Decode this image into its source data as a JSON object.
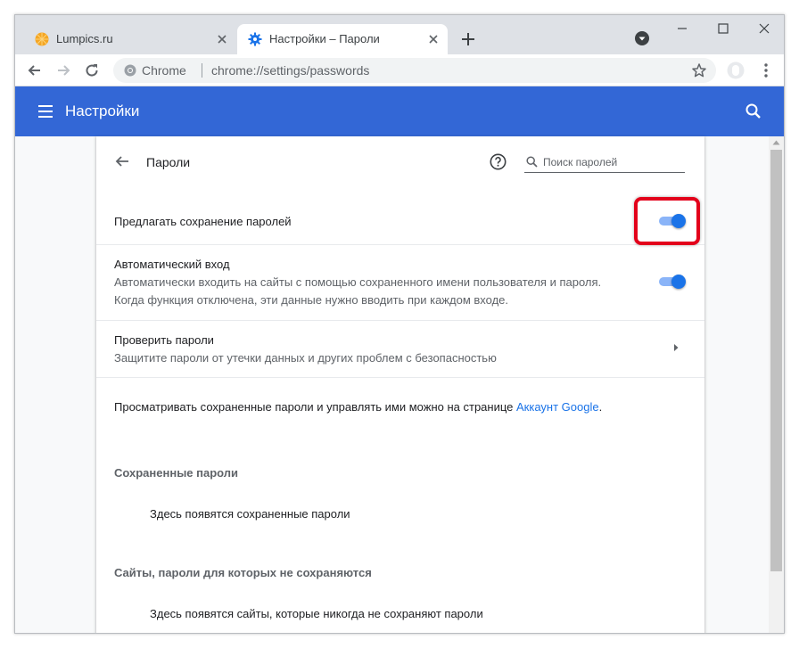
{
  "tabs": [
    {
      "title": "Lumpics.ru",
      "favicon": "orange-circle-icon",
      "active": false
    },
    {
      "title": "Настройки – Пароли",
      "favicon": "gear-icon",
      "active": true
    }
  ],
  "toolbar": {
    "site_name": "Chrome",
    "url": "chrome://settings/passwords"
  },
  "header": {
    "title": "Настройки"
  },
  "passwords_page": {
    "title": "Пароли",
    "search_placeholder": "Поиск паролей",
    "offer_save": {
      "label": "Предлагать сохранение паролей",
      "enabled": true
    },
    "auto_signin": {
      "label": "Автоматический вход",
      "description_line1": "Автоматически входить на сайты с помощью сохраненного имени пользователя и пароля.",
      "description_line2": "Когда функция отключена, эти данные нужно вводить при каждом входе.",
      "enabled": true
    },
    "check_passwords": {
      "label": "Проверить пароли",
      "description": "Защитите пароли от утечки данных и других проблем с безопасностью"
    },
    "manage_text": "Просматривать сохраненные пароли и управлять ими можно на странице ",
    "manage_link": "Аккаунт Google",
    "manage_text_end": ".",
    "saved_section": {
      "title": "Сохраненные пароли",
      "empty": "Здесь появятся сохраненные пароли"
    },
    "never_saved_section": {
      "title": "Сайты, пароли для которых не сохраняются",
      "empty": "Здесь появятся сайты, которые никогда не сохраняют пароли"
    }
  },
  "colors": {
    "header_blue": "#3367d6",
    "toggle_on": "#1a73e8",
    "highlight_red": "#e3001b"
  }
}
